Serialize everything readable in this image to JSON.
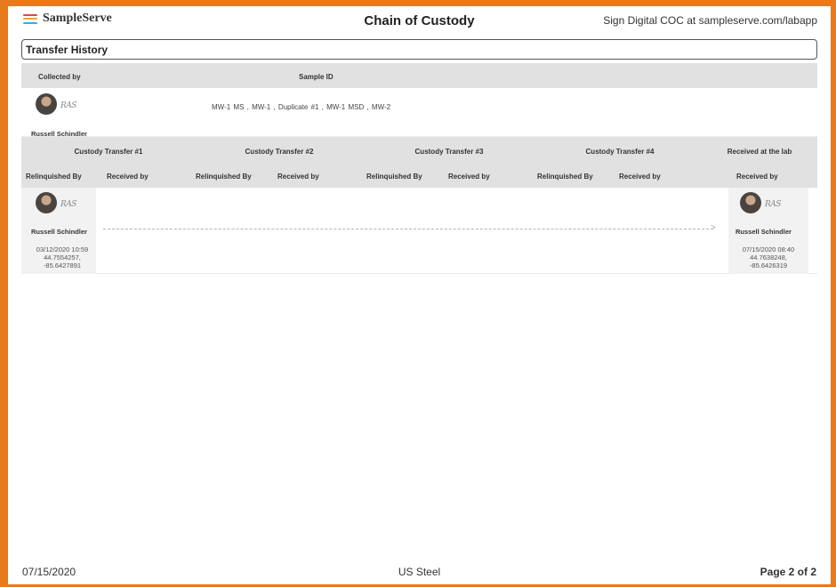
{
  "header": {
    "logo_text": "SampleServe",
    "logo_colors": [
      "#e8453c",
      "#f4a23a",
      "#4aa3df"
    ],
    "title": "Chain of Custody",
    "sign_link": "Sign Digital COC at sampleserve.com/labapp"
  },
  "section_title": "Transfer History",
  "collected": {
    "collected_by_label": "Collected by",
    "sample_id_label": "Sample ID",
    "signature": "RAS",
    "collector_name": "Russell Schindler",
    "sample_ids": "MW-1 MS ,  MW-1 ,  Duplicate #1 ,  MW-1 MSD ,  MW-2"
  },
  "transfers": {
    "headers": [
      "Custody Transfer #1",
      "Custody Transfer #2",
      "Custody Transfer #3",
      "Custody Transfer #4",
      "Received at the lab"
    ],
    "relinquished_label": "Relinquished By",
    "received_label": "Received by",
    "relinquished": {
      "signature": "RAS",
      "name": "Russell Schindler",
      "datetime": "03/12/2020 10:59",
      "lat": "44.7554257,",
      "lon": "-85.6427891"
    },
    "lab_received": {
      "signature": "RAS",
      "name": "Russell Schindler",
      "datetime": "07/15/2020 08:40",
      "lat": "44.7638248,",
      "lon": "-85.6426319"
    }
  },
  "footer": {
    "date": "07/15/2020",
    "client": "US Steel",
    "page": "Page 2 of 2"
  }
}
